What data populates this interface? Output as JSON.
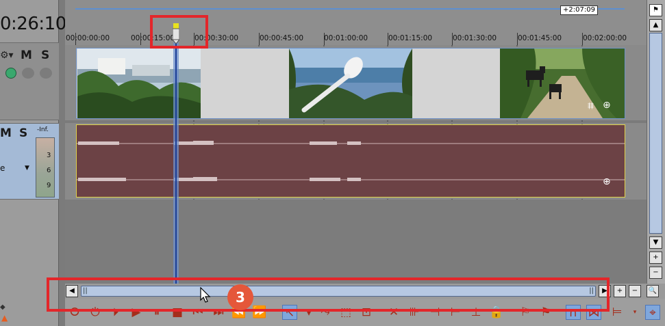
{
  "timecode": "0:26:10",
  "video_track": {
    "mute_label": "M",
    "solo_label": "S"
  },
  "audio_track": {
    "mute_label": "M",
    "solo_label": "S",
    "meter_top": "-Inf.",
    "meter_ticks": [
      "3",
      "6",
      "9"
    ],
    "mode_initial": "e"
  },
  "ruler": {
    "duration_label": "+2:07:09",
    "ticks": [
      "00:00:00:00",
      "00:00:15:00",
      "00:00:30:00",
      "00:00:45:00",
      "00:01:00:00",
      "00:01:15:00",
      "00:01:30:00",
      "00:01:45:00",
      "00:02:00:00"
    ]
  },
  "annotation": {
    "step_number": "3"
  },
  "colors": {
    "highlight": "#e3262a",
    "badge": "#e5573a",
    "audio_clip": "#6c4245",
    "video_border": "#6f92c8"
  }
}
